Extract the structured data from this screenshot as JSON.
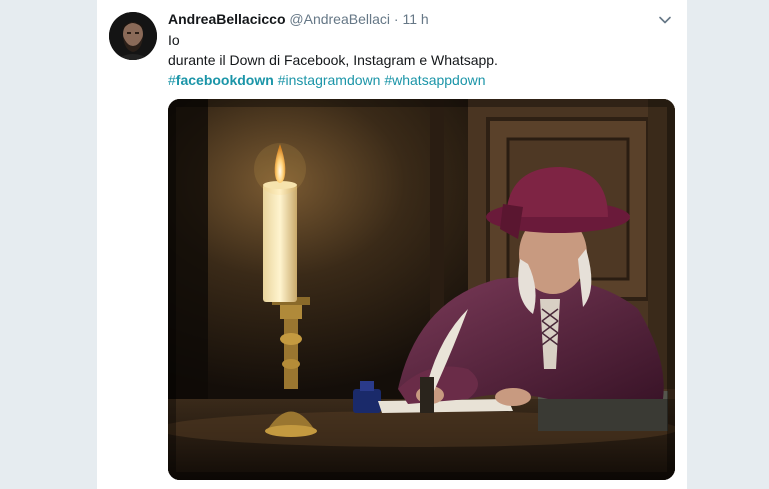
{
  "tweet": {
    "fullname": "AndreaBellacicco",
    "username": "@AndreaBellaci",
    "separator": "·",
    "timestamp": "11 h",
    "line1": "Io",
    "line2": "durante il Down di Facebook, Instagram e Whatsapp.",
    "hashtags": [
      {
        "hash": "#",
        "tag": "facebookdown",
        "bold": true
      },
      {
        "hash": "#",
        "tag": "instagramdown",
        "bold": false
      },
      {
        "hash": "#",
        "tag": "whatsappdown",
        "bold": false
      }
    ],
    "more_icon": "chevron-down-icon",
    "media_description_icon": "photo"
  },
  "colors": {
    "background": "#e6ecf0",
    "card": "#ffffff",
    "hashtag": "#1b95a8",
    "secondary_text": "#657786",
    "primary_text": "#14171a"
  }
}
